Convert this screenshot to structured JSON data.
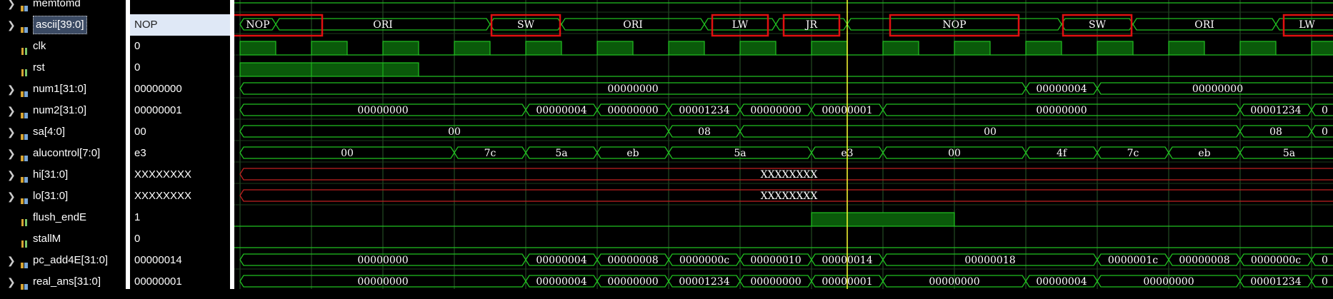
{
  "signals": [
    {
      "name": "memtomd",
      "value": "",
      "expandable": true,
      "type": "bus"
    },
    {
      "name": "ascii[39:0]",
      "value": "NOP",
      "expandable": true,
      "type": "bus",
      "selected": true
    },
    {
      "name": "clk",
      "value": "0",
      "expandable": false,
      "type": "bit"
    },
    {
      "name": "rst",
      "value": "0",
      "expandable": false,
      "type": "bit"
    },
    {
      "name": "num1[31:0]",
      "value": "00000000",
      "expandable": true,
      "type": "bus"
    },
    {
      "name": "num2[31:0]",
      "value": "00000001",
      "expandable": true,
      "type": "bus"
    },
    {
      "name": "sa[4:0]",
      "value": "00",
      "expandable": true,
      "type": "bus"
    },
    {
      "name": "alucontrol[7:0]",
      "value": "e3",
      "expandable": true,
      "type": "bus"
    },
    {
      "name": "hi[31:0]",
      "value": "XXXXXXXX",
      "expandable": true,
      "type": "bus"
    },
    {
      "name": "lo[31:0]",
      "value": "XXXXXXXX",
      "expandable": true,
      "type": "bus"
    },
    {
      "name": "flush_endE",
      "value": "1",
      "expandable": false,
      "type": "bit"
    },
    {
      "name": "stallM",
      "value": "0",
      "expandable": false,
      "type": "bit"
    },
    {
      "name": "pc_add4E[31:0]",
      "value": "00000014",
      "expandable": true,
      "type": "bus"
    },
    {
      "name": "real_ans[31:0]",
      "value": "00000001",
      "expandable": true,
      "type": "bus"
    }
  ],
  "waves": {
    "ascii": [
      {
        "t0": 0,
        "t1": 0.5,
        "label": "NOP"
      },
      {
        "t0": 0.5,
        "t1": 3.5,
        "label": "ORI"
      },
      {
        "t0": 3.5,
        "t1": 4.5,
        "label": "SW"
      },
      {
        "t0": 4.5,
        "t1": 6.5,
        "label": "ORI"
      },
      {
        "t0": 6.5,
        "t1": 7.5,
        "label": "LW"
      },
      {
        "t0": 7.5,
        "t1": 8.5,
        "label": "JR"
      },
      {
        "t0": 8.5,
        "t1": 11.5,
        "label": "NOP"
      },
      {
        "t0": 11.5,
        "t1": 12.5,
        "label": "SW"
      },
      {
        "t0": 12.5,
        "t1": 14.5,
        "label": "ORI"
      },
      {
        "t0": 14.5,
        "t1": 15.5,
        "label": "LW"
      }
    ],
    "rst_high_until": 2.5,
    "flush_high": [
      8,
      10
    ],
    "num1": [
      {
        "t0": 0,
        "t1": 11,
        "label": "00000000"
      },
      {
        "t0": 11,
        "t1": 12,
        "label": "00000004"
      },
      {
        "t0": 12,
        "t1": 15.5,
        "label": "00000000"
      }
    ],
    "num2": [
      {
        "t0": 0,
        "t1": 4,
        "label": "00000000"
      },
      {
        "t0": 4,
        "t1": 5,
        "label": "00000004"
      },
      {
        "t0": 5,
        "t1": 6,
        "label": "00000000"
      },
      {
        "t0": 6,
        "t1": 7,
        "label": "00001234"
      },
      {
        "t0": 7,
        "t1": 8,
        "label": "00000000"
      },
      {
        "t0": 8,
        "t1": 9,
        "label": "00000001"
      },
      {
        "t0": 9,
        "t1": 14,
        "label": "00000000"
      },
      {
        "t0": 14,
        "t1": 15,
        "label": "00001234"
      },
      {
        "t0": 15,
        "t1": 15.5,
        "label": "0"
      }
    ],
    "sa": [
      {
        "t0": 0,
        "t1": 6,
        "label": "00"
      },
      {
        "t0": 6,
        "t1": 7,
        "label": "08"
      },
      {
        "t0": 7,
        "t1": 14,
        "label": "00"
      },
      {
        "t0": 14,
        "t1": 15,
        "label": "08"
      },
      {
        "t0": 15,
        "t1": 15.5,
        "label": "0"
      }
    ],
    "alucontrol": [
      {
        "t0": 0,
        "t1": 3,
        "label": "00"
      },
      {
        "t0": 3,
        "t1": 4,
        "label": "7c"
      },
      {
        "t0": 4,
        "t1": 5,
        "label": "5a"
      },
      {
        "t0": 5,
        "t1": 6,
        "label": "eb"
      },
      {
        "t0": 6,
        "t1": 8,
        "label": "5a"
      },
      {
        "t0": 8,
        "t1": 9,
        "label": "e3"
      },
      {
        "t0": 9,
        "t1": 11,
        "label": "00"
      },
      {
        "t0": 11,
        "t1": 12,
        "label": "4f"
      },
      {
        "t0": 12,
        "t1": 13,
        "label": "7c"
      },
      {
        "t0": 13,
        "t1": 14,
        "label": "eb"
      },
      {
        "t0": 14,
        "t1": 15.5,
        "label": "5a"
      }
    ],
    "hi": [
      {
        "t0": 0,
        "t1": 15.5,
        "label": "XXXXXXXX"
      }
    ],
    "lo": [
      {
        "t0": 0,
        "t1": 15.5,
        "label": "XXXXXXXX"
      }
    ],
    "pc_add4E": [
      {
        "t0": 0,
        "t1": 4,
        "label": "00000000"
      },
      {
        "t0": 4,
        "t1": 5,
        "label": "00000004"
      },
      {
        "t0": 5,
        "t1": 6,
        "label": "00000008"
      },
      {
        "t0": 6,
        "t1": 7,
        "label": "0000000c"
      },
      {
        "t0": 7,
        "t1": 8,
        "label": "00000010"
      },
      {
        "t0": 8,
        "t1": 9,
        "label": "00000014"
      },
      {
        "t0": 9,
        "t1": 12,
        "label": "00000018"
      },
      {
        "t0": 12,
        "t1": 13,
        "label": "0000001c"
      },
      {
        "t0": 13,
        "t1": 14,
        "label": "00000008"
      },
      {
        "t0": 14,
        "t1": 15,
        "label": "0000000c"
      },
      {
        "t0": 15,
        "t1": 15.5,
        "label": "0"
      }
    ],
    "real_ans": [
      {
        "t0": 0,
        "t1": 4,
        "label": "00000000"
      },
      {
        "t0": 4,
        "t1": 5,
        "label": "00000004"
      },
      {
        "t0": 5,
        "t1": 6,
        "label": "00000000"
      },
      {
        "t0": 6,
        "t1": 7,
        "label": "00001234"
      },
      {
        "t0": 7,
        "t1": 8,
        "label": "00000000"
      },
      {
        "t0": 8,
        "t1": 9,
        "label": "00000001"
      },
      {
        "t0": 9,
        "t1": 11,
        "label": "00000000"
      },
      {
        "t0": 11,
        "t1": 12,
        "label": "00000004"
      },
      {
        "t0": 12,
        "t1": 14,
        "label": "00000000"
      },
      {
        "t0": 14,
        "t1": 15,
        "label": "00001234"
      },
      {
        "t0": 15,
        "t1": 15.5,
        "label": "0"
      }
    ],
    "cursor_time": 8.5,
    "highlighted_labels": [
      "LW",
      "JR",
      "NOP",
      "SW"
    ]
  },
  "colors": {
    "wave": "#21c021",
    "wave_fill": "#0a5a0a",
    "unknown": "#c02020",
    "cursor": "#ffff33",
    "highlight_box": "#e01010",
    "grid": "#2a5a2a"
  }
}
